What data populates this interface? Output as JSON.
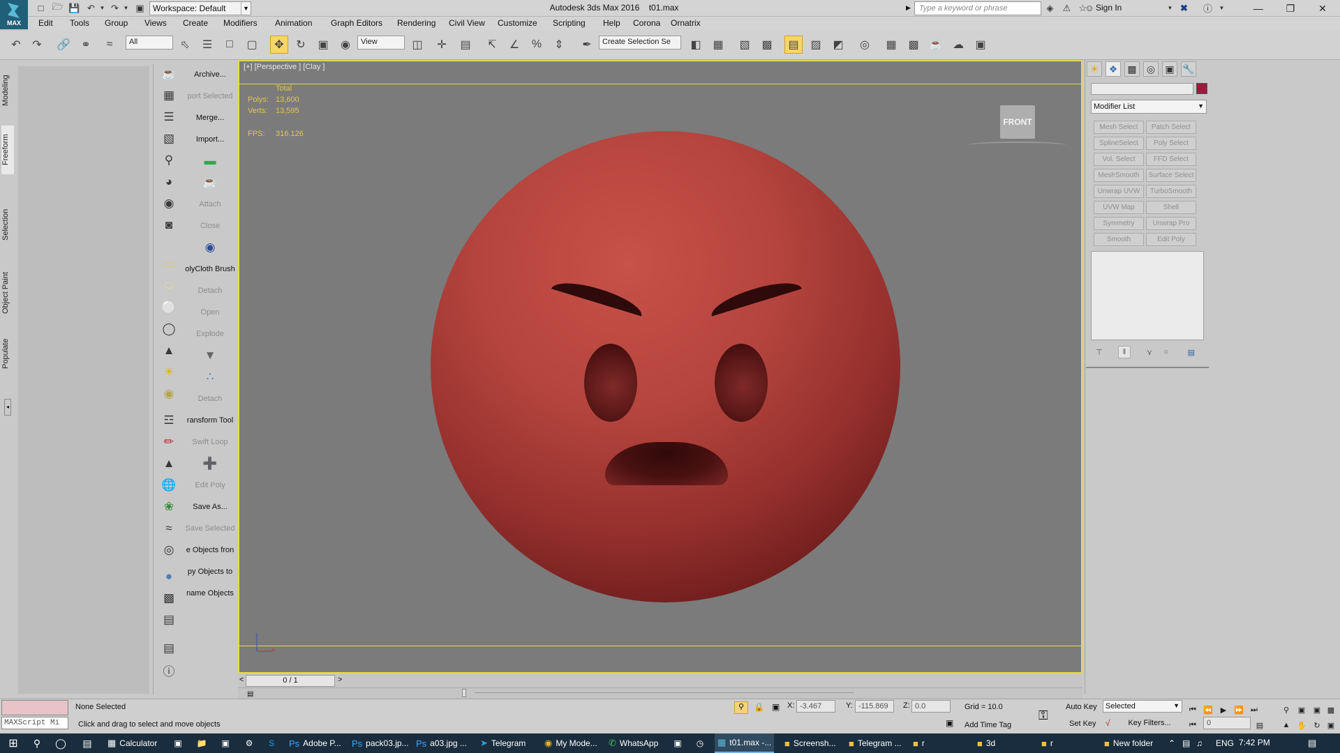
{
  "window": {
    "title": "Autodesk 3ds Max 2016",
    "filename": "t01.max",
    "logo_text": "MAX",
    "workspace": "Workspace: Default",
    "search_placeholder": "Type a keyword or phrase",
    "signin": "Sign In"
  },
  "menubar": [
    "Edit",
    "Tools",
    "Group",
    "Views",
    "Create",
    "Modifiers",
    "Animation",
    "Graph Editors",
    "Rendering",
    "Civil View",
    "Customize",
    "Scripting",
    "Help",
    "Corona",
    "Ornatrix"
  ],
  "toolbar": {
    "selection_filter": "All",
    "ref_coord": "View",
    "named_selection": "Create Selection Se"
  },
  "ribbon_tabs": [
    "Modeling",
    "Freeform",
    "Selection",
    "Object Paint",
    "Populate"
  ],
  "scripts_panel": [
    {
      "label": "Archive...",
      "disabled": false
    },
    {
      "label": "port Selected",
      "disabled": true
    },
    {
      "label": "Merge...",
      "disabled": false
    },
    {
      "label": "Import...",
      "disabled": false
    },
    {
      "label": "",
      "disabled": false,
      "icon": "green-rect-icon"
    },
    {
      "label": "",
      "disabled": true,
      "icon": "teapot-icon"
    },
    {
      "label": "Attach",
      "disabled": true
    },
    {
      "label": "Close",
      "disabled": true
    },
    {
      "label": "",
      "disabled": false,
      "icon": "qr-icon"
    },
    {
      "label": "olyCloth Brush",
      "disabled": false
    },
    {
      "label": "Detach",
      "disabled": true
    },
    {
      "label": "Open",
      "disabled": true
    },
    {
      "label": "Explode",
      "disabled": true
    },
    {
      "label": "",
      "disabled": true,
      "icon": "shield-icon"
    },
    {
      "label": "",
      "disabled": false,
      "icon": "dots-icon"
    },
    {
      "label": "Detach",
      "disabled": true
    },
    {
      "label": "ransform Tool",
      "disabled": false
    },
    {
      "label": "Swift Loop",
      "disabled": true
    },
    {
      "label": "",
      "disabled": true,
      "icon": "loop-icon"
    },
    {
      "label": "Edit Poly",
      "disabled": true
    },
    {
      "label": "Save As...",
      "disabled": false
    },
    {
      "label": "Save Selected",
      "disabled": true
    },
    {
      "label": "e Objects fron",
      "disabled": false
    },
    {
      "label": "py Objects to",
      "disabled": false
    },
    {
      "label": "name Objects",
      "disabled": false
    }
  ],
  "viewport": {
    "label": "[+] [Perspective ] [Clay ]",
    "stats_header": "Total",
    "polys_label": "Polys:",
    "polys": "13,600",
    "verts_label": "Verts:",
    "verts": "13,595",
    "fps_label": "FPS:",
    "fps": "316.126",
    "viewcube": "FRONT"
  },
  "timeslider": {
    "frame": "0 / 1"
  },
  "command_panel": {
    "modifier_list": "Modifier List",
    "swatch_color": "#9e1a3c",
    "modifier_buttons": [
      "Mesh Select",
      "Patch Select",
      "SplineSelect",
      "Poly Select",
      "Vol. Select",
      "FFD Select",
      "MeshSmooth",
      "Surface Select",
      "Unwrap UVW",
      "TurboSmooth",
      "UVW Map",
      "Shell",
      "Symmetry",
      "Unwrap Pro",
      "Smooth",
      "Edit Poly"
    ]
  },
  "status": {
    "maxscript": "MAXScript Mi",
    "selection": "None Selected",
    "prompt": "Click and drag to select and move objects",
    "x_label": "X:",
    "x": "-3.467",
    "y_label": "Y:",
    "y": "-115.869",
    "z_label": "Z:",
    "z": "0.0",
    "grid": "Grid = 10.0",
    "add_time_tag": "Add Time Tag",
    "auto_key": "Auto Key",
    "set_key": "Set Key",
    "key_mode": "Selected",
    "key_filters": "Key Filters...",
    "frame": "0"
  },
  "taskbar": {
    "apps": [
      "Calculator",
      "Adobe P...",
      "pack03.jp...",
      "a03.jpg ...",
      "Telegram",
      "My Mode...",
      "WhatsApp",
      "t01.max -...",
      "Screensh...",
      "Telegram ...",
      "r",
      "3d",
      "r",
      "New folder"
    ],
    "lang": "ENG",
    "time": "7:42 PM"
  }
}
